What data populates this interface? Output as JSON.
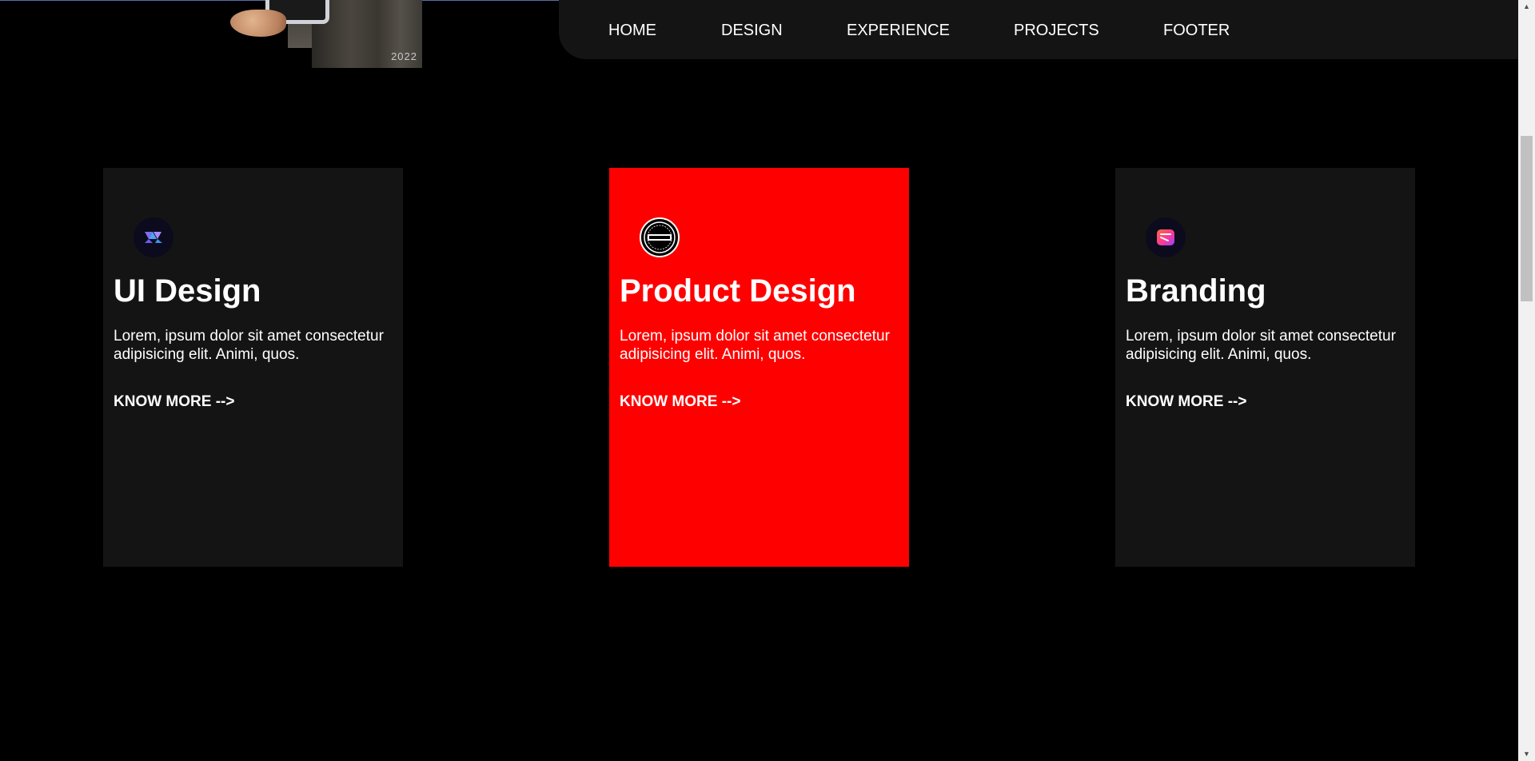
{
  "hero": {
    "year": "2022"
  },
  "nav": {
    "items": [
      {
        "label": "HOME"
      },
      {
        "label": "DESIGN"
      },
      {
        "label": "EXPERIENCE"
      },
      {
        "label": "PROJECTS"
      },
      {
        "label": "FOOTER"
      }
    ]
  },
  "services": [
    {
      "title": "UI Design",
      "description": "Lorem, ipsum dolor sit amet consectetur adipisicing elit. Animi, quos.",
      "link": "KNOW MORE -->",
      "icon": "ui-design-logo-icon",
      "active": false
    },
    {
      "title": "Product Design",
      "description": "Lorem, ipsum dolor sit amet consectetur adipisicing elit. Animi, quos.",
      "link": "KNOW MORE -->",
      "icon": "organic-badge-logo-icon",
      "active": true
    },
    {
      "title": "Branding",
      "description": "Lorem, ipsum dolor sit amet consectetur adipisicing elit. Animi, quos.",
      "link": "KNOW MORE -->",
      "icon": "branding-logo-icon",
      "active": false
    }
  ],
  "colors": {
    "background": "#000000",
    "card": "#141414",
    "active_card": "#ff0000",
    "nav": "#141414",
    "text": "#ffffff"
  }
}
